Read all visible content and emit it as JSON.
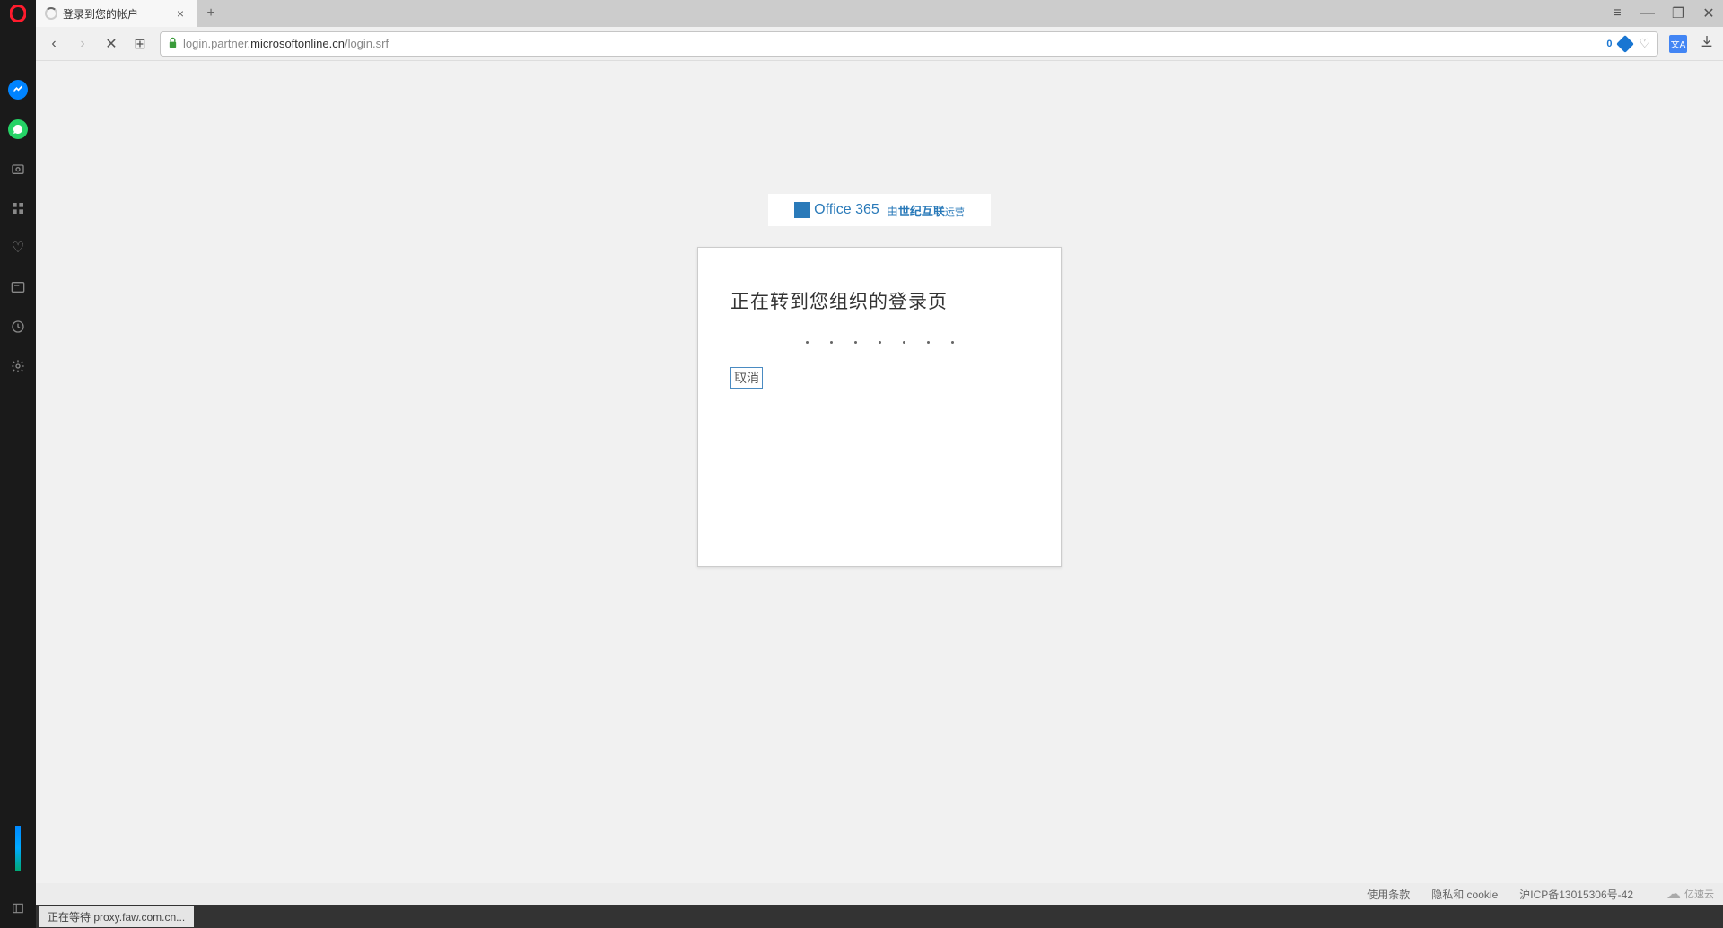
{
  "browser": {
    "tab_title": "登录到您的帐户",
    "url_prefix": "login.partner.",
    "url_domain": "microsoftonline.cn",
    "url_path": "/login.srf",
    "blocked_count": "0"
  },
  "window_controls": {
    "easy_setup": "≡",
    "minimize": "—",
    "maximize": "❐",
    "close": "✕"
  },
  "nav": {
    "back": "‹",
    "forward": "›",
    "stop": "✕",
    "speed_dial": "⊞"
  },
  "logo": {
    "brand": "Office 365",
    "operator_prefix": "由",
    "operator_bold": "世纪互联",
    "operator_suffix": "运营"
  },
  "card": {
    "heading": "正在转到您组织的登录页",
    "cancel": "取消"
  },
  "footer": {
    "terms": "使用条款",
    "privacy": "隐私和 cookie",
    "icp": "沪ICP备13015306号-42"
  },
  "watermark": {
    "text": "亿速云"
  },
  "status": {
    "waiting": "正在等待 proxy.faw.com.cn..."
  }
}
